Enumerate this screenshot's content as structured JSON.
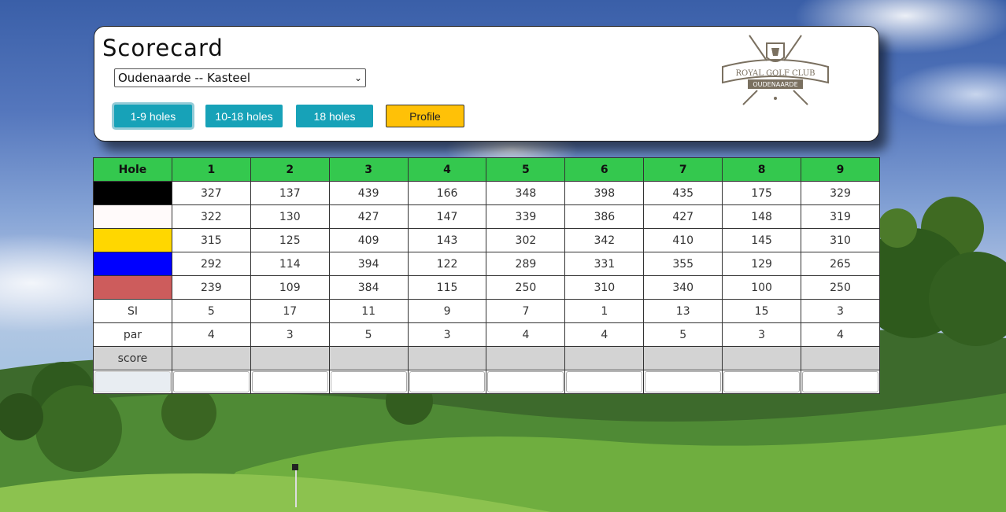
{
  "header": {
    "title": "Scorecard",
    "course_select": "Oudenaarde -- Kasteel",
    "buttons": [
      "1-9 holes",
      "10-18 holes",
      "18 holes",
      "Profile"
    ],
    "logo_text": [
      "ROYAL GOLF CLUB",
      "OUDENAARDE"
    ]
  },
  "table": {
    "header": [
      "Hole",
      "1",
      "2",
      "3",
      "4",
      "5",
      "6",
      "7",
      "8",
      "9"
    ],
    "tees": [
      {
        "color": "#000000",
        "values": [
          "327",
          "137",
          "439",
          "166",
          "348",
          "398",
          "435",
          "175",
          "329"
        ]
      },
      {
        "color": "#fffafa",
        "values": [
          "322",
          "130",
          "427",
          "147",
          "339",
          "386",
          "427",
          "148",
          "319"
        ]
      },
      {
        "color": "#ffd700",
        "values": [
          "315",
          "125",
          "409",
          "143",
          "302",
          "342",
          "410",
          "145",
          "310"
        ]
      },
      {
        "color": "#0000ff",
        "values": [
          "292",
          "114",
          "394",
          "122",
          "289",
          "331",
          "355",
          "129",
          "265"
        ]
      },
      {
        "color": "#cd5c5c",
        "values": [
          "239",
          "109",
          "384",
          "115",
          "250",
          "310",
          "340",
          "100",
          "250"
        ]
      }
    ],
    "si": {
      "label": "SI",
      "values": [
        "5",
        "17",
        "11",
        "9",
        "7",
        "1",
        "13",
        "15",
        "3"
      ]
    },
    "par": {
      "label": "par",
      "values": [
        "4",
        "3",
        "5",
        "3",
        "4",
        "4",
        "5",
        "3",
        "4"
      ]
    },
    "score": {
      "label": "score"
    }
  }
}
